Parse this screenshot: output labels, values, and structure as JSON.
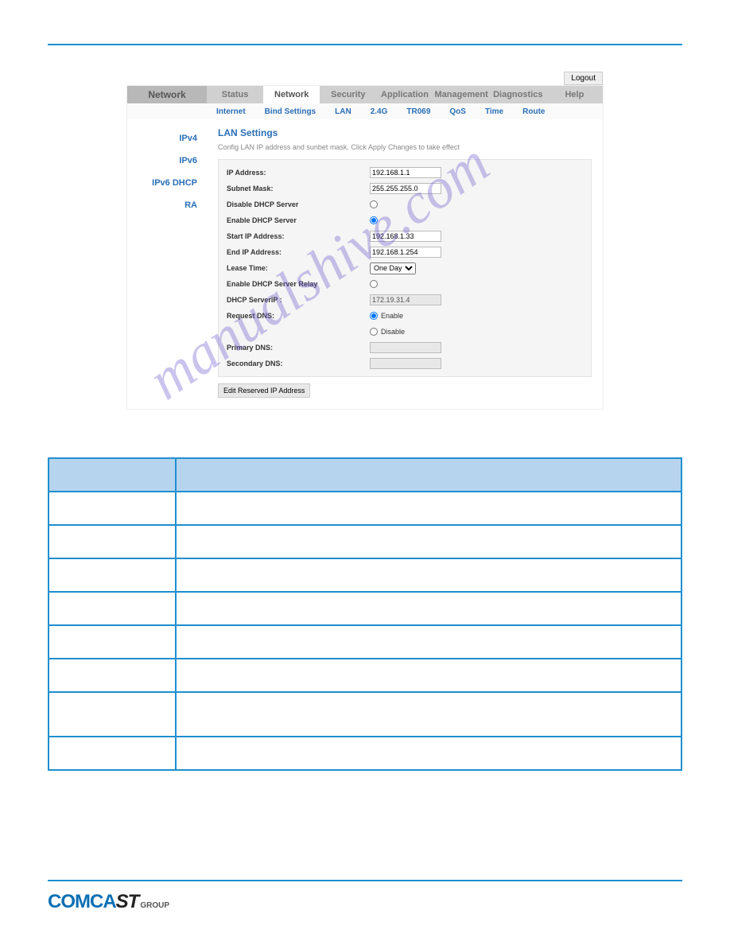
{
  "logout": "Logout",
  "brand": "Network",
  "tabs": [
    "Status",
    "Network",
    "Security",
    "Application",
    "Management",
    "Diagnostics",
    "Help"
  ],
  "subtabs": [
    "Internet",
    "Bind Settings",
    "LAN",
    "2.4G",
    "TR069",
    "QoS",
    "Time",
    "Route"
  ],
  "sidebar": [
    "IPv4",
    "IPv6",
    "IPv6 DHCP",
    "RA"
  ],
  "title": "LAN Settings",
  "desc": "Config LAN IP address and sunbet mask, Click Apply Changes to take effect",
  "fields": {
    "ip_label": "IP Address:",
    "ip_value": "192.168.1.1",
    "subnet_label": "Subnet Mask:",
    "subnet_value": "255.255.255.0",
    "disable_dhcp": "Disable DHCP Server",
    "enable_dhcp": "Enable DHCP Server",
    "start_label": "Start IP Address:",
    "start_value": "192.168.1.33",
    "end_label": "End IP Address:",
    "end_value": "192.168.1.254",
    "lease_label": "Lease Time:",
    "lease_value": "One Day",
    "relay_label": "Enable DHCP Server Relay",
    "serverip_label": "DHCP ServerIP :",
    "serverip_value": "172.19.31.4",
    "reqdns_label": "Request DNS:",
    "enable": "Enable",
    "disable": "Disable",
    "primary_label": "Primary DNS:",
    "secondary_label": "Secondary DNS:"
  },
  "button": "Edit Reserved IP  Address",
  "watermark": "manualshive.com",
  "logo": {
    "a": "COMCA",
    "b": "ST",
    "c": "GROUP"
  }
}
